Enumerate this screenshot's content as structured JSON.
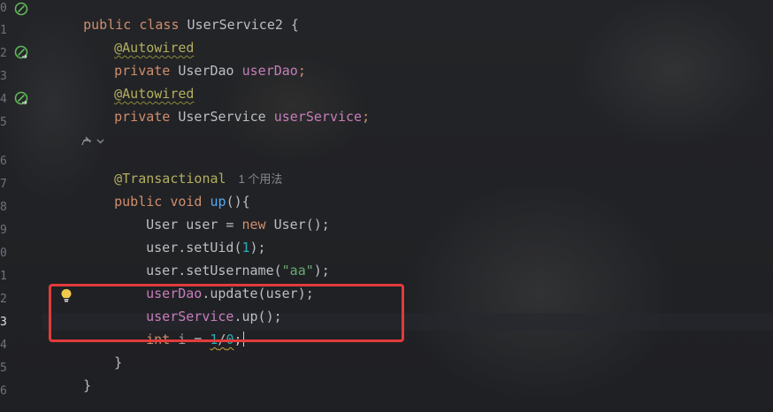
{
  "gutter": {
    "line_numbers": [
      "0",
      "1",
      "2",
      "3",
      "4",
      "5",
      "",
      "6",
      "7",
      "8",
      "9",
      "0",
      "1",
      "2",
      "3",
      "4",
      "5",
      "6"
    ],
    "current_line": "3"
  },
  "code": {
    "l0_kw": "public class ",
    "l0_name": "UserService2 {",
    "l1_ann": "@Autowired",
    "l2_kw": "private ",
    "l2_type": "UserDao ",
    "l2_field": "userDao",
    "l2_end": ";",
    "l3_ann": "@Autowired",
    "l4_kw": "private ",
    "l4_type": "UserService ",
    "l4_field": "userService",
    "l4_end": ";",
    "l6_ann": "@Transactional",
    "l6_hint": "1 个用法",
    "l7_kw": "public void ",
    "l7_fn": "up",
    "l7_end": "(){",
    "l8_a": "User user = ",
    "l8_kw": "new ",
    "l8_b": "User();",
    "l9_a": "user.setUid(",
    "l9_num": "1",
    "l9_b": ");",
    "l10_a": "user.setUsername(",
    "l10_str": "\"aa\"",
    "l10_b": ");",
    "l11_field": "userDao",
    "l11_b": ".update(user);",
    "l12_field": "userService",
    "l12_b": ".up();",
    "l13_kw": "int ",
    "l13_var": "i",
    "l13_eq": " = ",
    "l13_num1": "1",
    "l13_slash": "/",
    "l13_num2": "0",
    "l13_end": ";",
    "l14": "}",
    "l15": "}"
  },
  "icons": {
    "bean": "spring-bean-gutter-icon",
    "bulb": "lightbulb-intention-icon",
    "ai": "ai-assistant-icon"
  },
  "colors": {
    "keyword": "#cf8e6d",
    "annotation": "#b3ae60",
    "field": "#c77dbb",
    "function": "#56a8f5",
    "number": "#2aacb8",
    "string": "#6aab73",
    "highlight_box": "#e23b3b"
  }
}
